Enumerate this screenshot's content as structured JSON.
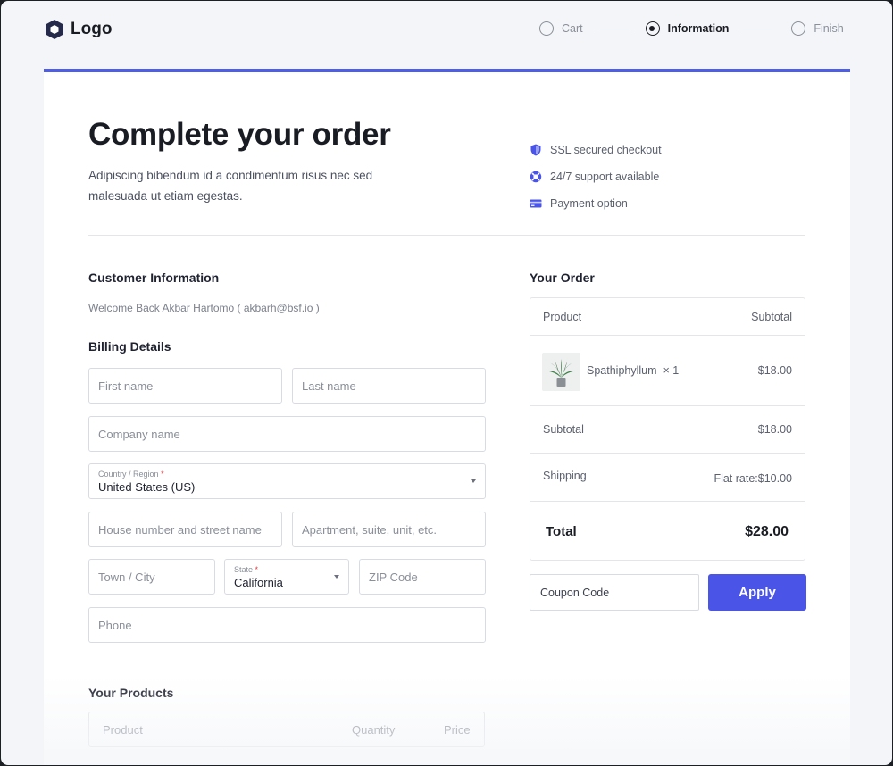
{
  "header": {
    "logo_text": "Logo",
    "steps": [
      {
        "label": "Cart",
        "state": "inactive"
      },
      {
        "label": "Information",
        "state": "active"
      },
      {
        "label": "Finish",
        "state": "inactive"
      }
    ]
  },
  "hero": {
    "title": "Complete your order",
    "subtitle": "Adipiscing bibendum id a condimentum risus nec sed malesuada ut etiam egestas."
  },
  "features": [
    {
      "icon": "shield-icon",
      "label": "SSL secured checkout"
    },
    {
      "icon": "lifebuoy-icon",
      "label": "24/7 support available"
    },
    {
      "icon": "credit-card-icon",
      "label": "Payment option"
    }
  ],
  "customer": {
    "section_title": "Customer Information",
    "welcome": "Welcome Back Akbar Hartomo ( akbarh@bsf.io )"
  },
  "billing": {
    "section_title": "Billing Details",
    "first_name_placeholder": "First name",
    "last_name_placeholder": "Last name",
    "company_placeholder": "Company name",
    "country_label": "Country / Region",
    "country_value": "United States (US)",
    "street_placeholder": "House number and street name",
    "apartment_placeholder": "Apartment, suite, unit, etc.",
    "city_placeholder": "Town / City",
    "state_label": "State",
    "state_value": "California",
    "zip_placeholder": "ZIP Code",
    "phone_placeholder": "Phone",
    "required_mark": "*"
  },
  "products": {
    "section_title": "Your Products",
    "columns": [
      "Product",
      "Quantity",
      "Price"
    ]
  },
  "order": {
    "section_title": "Your Order",
    "col_product": "Product",
    "col_subtotal": "Subtotal",
    "item_name": "Spathiphyllum",
    "item_qty": "× 1",
    "item_price": "$18.00",
    "subtotal_label": "Subtotal",
    "subtotal_value": "$18.00",
    "shipping_label": "Shipping",
    "shipping_value": "Flat rate:$10.00",
    "total_label": "Total",
    "total_value": "$28.00"
  },
  "coupon": {
    "placeholder": "Coupon Code",
    "apply_label": "Apply"
  },
  "colors": {
    "accent": "#4a55e8",
    "text_dark": "#1a1c24",
    "required": "#e0383e"
  }
}
